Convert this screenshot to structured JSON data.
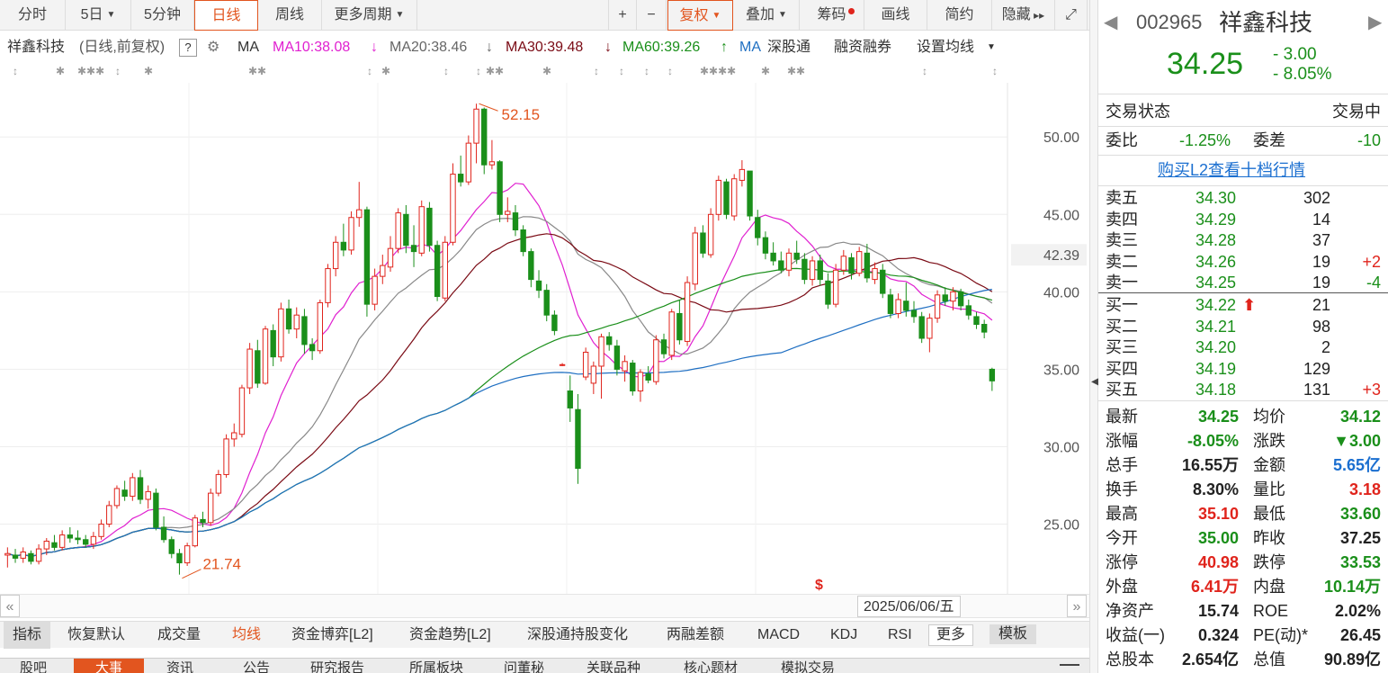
{
  "period_bar": {
    "buttons": [
      "分时",
      "5日",
      "5分钟",
      "日线",
      "周线",
      "更多周期"
    ],
    "tools": [
      "+",
      "−",
      "复权",
      "叠加",
      "筹码",
      "画线",
      "简约",
      "隐藏"
    ]
  },
  "ma_bar": {
    "name": "祥鑫科技",
    "mode": "(日线,前复权)",
    "help": "?",
    "ma_label": "MA",
    "ma10": "MA10:38.08",
    "ma20": "MA20:38.46",
    "ma30": "MA30:39.48",
    "ma60": "MA60:39.26",
    "ma_blue": "MA",
    "hk": "深股通",
    "margin": "融资融券",
    "set_ma": "设置均线"
  },
  "colors": {
    "up": "#e0241c",
    "down": "#1a8f1a",
    "ma10": "#e020d0",
    "ma20": "#888888",
    "ma30": "#7a0a14",
    "ma60": "#1a8f1a",
    "ma120": "#1f6fc2",
    "accent": "#e2551f"
  },
  "chart_data": {
    "type": "candlestick",
    "title": "",
    "y_ticks": [
      "50.00",
      "45.00",
      "40.00",
      "35.00",
      "30.00",
      "25.00"
    ],
    "ylim": [
      20.5,
      53.5
    ],
    "last_price_label": "42.39",
    "max_label": "52.15",
    "min_label": "21.74",
    "date_label": "2025/06/06/五",
    "candles": [
      [
        23,
        23.5,
        22.2,
        23.1
      ],
      [
        23,
        23.4,
        22.5,
        22.8
      ],
      [
        22.8,
        23.5,
        22.5,
        23.2
      ],
      [
        23.1,
        23.3,
        22.4,
        22.6
      ],
      [
        22.6,
        23.7,
        22.4,
        23.4
      ],
      [
        23.4,
        24.1,
        23,
        23.9
      ],
      [
        23.8,
        24.3,
        23.3,
        23.5
      ],
      [
        23.5,
        24.6,
        23.3,
        24.3
      ],
      [
        24.3,
        24.8,
        23.8,
        24.1
      ],
      [
        24.1,
        24.6,
        23.7,
        24
      ],
      [
        24,
        24.3,
        23.5,
        23.7
      ],
      [
        23.7,
        24.5,
        23.4,
        24.2
      ],
      [
        24.2,
        25.3,
        24,
        25
      ],
      [
        25,
        26.5,
        24.8,
        26.2
      ],
      [
        26.2,
        27.5,
        26,
        27.3
      ],
      [
        27.2,
        27.8,
        26.5,
        26.8
      ],
      [
        26.8,
        28.3,
        26.5,
        28
      ],
      [
        28,
        28.5,
        26.3,
        26.6
      ],
      [
        26.6,
        27.5,
        26,
        27.1
      ],
      [
        27,
        27.3,
        24.6,
        24.8
      ],
      [
        24.8,
        25.5,
        23.8,
        24
      ],
      [
        24,
        24.2,
        22.8,
        23.1
      ],
      [
        23.1,
        23.4,
        21.74,
        22.5
      ],
      [
        22.5,
        23.8,
        22.3,
        23.6
      ],
      [
        23.6,
        25.6,
        23.5,
        25.4
      ],
      [
        25.3,
        25.8,
        24.8,
        25.1
      ],
      [
        25.1,
        27.3,
        24.9,
        27
      ],
      [
        27,
        28.5,
        26.8,
        28.2
      ],
      [
        28.2,
        30.8,
        28,
        30.5
      ],
      [
        30.5,
        31.5,
        30,
        30.9
      ],
      [
        30.8,
        34,
        30.6,
        33.8
      ],
      [
        33.8,
        36.7,
        33.4,
        36.3
      ],
      [
        36.2,
        36.9,
        33.8,
        34.1
      ],
      [
        34.1,
        37.8,
        34,
        37.6
      ],
      [
        37.5,
        37.9,
        35.2,
        35.8
      ],
      [
        35.8,
        39.3,
        35.5,
        38.9
      ],
      [
        38.9,
        39.5,
        37.3,
        37.6
      ],
      [
        37.6,
        39,
        37,
        38.5
      ],
      [
        38.4,
        38.9,
        36,
        36.6
      ],
      [
        36.6,
        37,
        35.6,
        36.2
      ],
      [
        36.2,
        39.5,
        36,
        39.3
      ],
      [
        39.3,
        41.8,
        39,
        41.5
      ],
      [
        41.5,
        43.6,
        41,
        43.2
      ],
      [
        43.2,
        44.4,
        42.3,
        42.7
      ],
      [
        42.7,
        45.2,
        42.4,
        44.8
      ],
      [
        44.8,
        47.1,
        44.2,
        45.3
      ],
      [
        45.3,
        45.5,
        38.4,
        39.2
      ],
      [
        39.2,
        41.5,
        38.8,
        41
      ],
      [
        41,
        42.4,
        40.5,
        41.7
      ],
      [
        41.6,
        43.6,
        41.3,
        42.8
      ],
      [
        42.8,
        45.4,
        42.5,
        45.1
      ],
      [
        45,
        45.6,
        42.5,
        43
      ],
      [
        43,
        44.3,
        41.6,
        42.6
      ],
      [
        42.5,
        45.9,
        42.3,
        45.5
      ],
      [
        45.4,
        45.8,
        42.6,
        43
      ],
      [
        43,
        43.3,
        39.4,
        39.7
      ],
      [
        39.6,
        43.6,
        39.4,
        43.2
      ],
      [
        43.2,
        48.3,
        43,
        47.6
      ],
      [
        47.6,
        48.8,
        46.8,
        47.1
      ],
      [
        47.1,
        50.1,
        46.9,
        49.6
      ],
      [
        49.6,
        52.15,
        48.3,
        51.8
      ],
      [
        51.8,
        51.9,
        47.6,
        48.2
      ],
      [
        48.2,
        49.8,
        47.9,
        48.4
      ],
      [
        48.4,
        48.5,
        44.5,
        45
      ],
      [
        45,
        46.1,
        44.5,
        45.2
      ],
      [
        45.1,
        45.6,
        43.6,
        44
      ],
      [
        44,
        44.3,
        42.3,
        42.6
      ],
      [
        42.6,
        42.8,
        40.3,
        40.8
      ],
      [
        40.7,
        41.4,
        39.6,
        40.1
      ],
      [
        40.1,
        40.5,
        38.1,
        38.5
      ],
      [
        38.5,
        38.8,
        37.2,
        37.5
      ],
      [
        35.3,
        35.4,
        35.2,
        35.3
      ],
      [
        33.6,
        34.6,
        31.6,
        32.5
      ],
      [
        32.4,
        33.4,
        27.6,
        28.6
      ],
      [
        34.5,
        36.4,
        34.3,
        36.1
      ],
      [
        34.1,
        35.5,
        33.4,
        35.2
      ],
      [
        35.2,
        37.3,
        33.1,
        37.1
      ],
      [
        37.1,
        37.4,
        36.2,
        36.6
      ],
      [
        36.5,
        36.9,
        34.6,
        35
      ],
      [
        34.9,
        35.9,
        34.2,
        35.5
      ],
      [
        35.4,
        35.6,
        33.3,
        33.6
      ],
      [
        33.6,
        35,
        32.9,
        34.8
      ],
      [
        34.7,
        35.2,
        34.1,
        34.3
      ],
      [
        34.2,
        37.2,
        34,
        36.9
      ],
      [
        36.9,
        37.3,
        35.7,
        36
      ],
      [
        35.9,
        38.9,
        35.6,
        38.7
      ],
      [
        38.6,
        39.5,
        36.6,
        36.9
      ],
      [
        36.8,
        41,
        36.5,
        40.6
      ],
      [
        40.5,
        44.2,
        40.1,
        43.8
      ],
      [
        43.8,
        44.3,
        42.2,
        42.5
      ],
      [
        42.4,
        45.4,
        42.2,
        45
      ],
      [
        45,
        47.5,
        44.6,
        47.2
      ],
      [
        47.1,
        47.3,
        44.7,
        45
      ],
      [
        44.9,
        47.6,
        44.6,
        47.3
      ],
      [
        47.2,
        48.5,
        46.8,
        47.9
      ],
      [
        47.8,
        47.8,
        44.6,
        44.9
      ],
      [
        44.8,
        45.3,
        43,
        43.5
      ],
      [
        43.5,
        43.9,
        42.1,
        42.5
      ],
      [
        42.5,
        43.2,
        41.7,
        42
      ],
      [
        42,
        42.6,
        41.2,
        41.4
      ],
      [
        41.4,
        42.8,
        41,
        42.5
      ],
      [
        42.5,
        43.3,
        41.8,
        42.1
      ],
      [
        42.1,
        42.5,
        40.5,
        40.8
      ],
      [
        40.8,
        42.3,
        40.4,
        42
      ],
      [
        42,
        42.4,
        40.4,
        40.8
      ],
      [
        40.7,
        41.2,
        38.9,
        39.2
      ],
      [
        39.2,
        41.8,
        39,
        41.4
      ],
      [
        41.4,
        42.7,
        41.1,
        42.3
      ],
      [
        42.2,
        42.5,
        40.8,
        41.2
      ],
      [
        41.2,
        42.9,
        41,
        42.6
      ],
      [
        42.5,
        43.1,
        40.6,
        40.9
      ],
      [
        40.8,
        41.9,
        40.5,
        41.5
      ],
      [
        41.4,
        41.8,
        39.6,
        39.9
      ],
      [
        39.8,
        40.2,
        38.3,
        38.6
      ],
      [
        38.6,
        39.9,
        38.3,
        39.5
      ],
      [
        39.4,
        40.6,
        38.4,
        38.8
      ],
      [
        38.8,
        39.4,
        38,
        38.4
      ],
      [
        38.4,
        38.7,
        36.7,
        37
      ],
      [
        37,
        38.6,
        36.1,
        38.3
      ],
      [
        38.3,
        40.1,
        38,
        39.8
      ],
      [
        39.8,
        40.3,
        39.1,
        39.4
      ],
      [
        39.4,
        40.3,
        38.8,
        40
      ],
      [
        40,
        40.2,
        38.8,
        39.1
      ],
      [
        39.1,
        39.5,
        38.2,
        38.5
      ],
      [
        38.4,
        38.7,
        37.6,
        37.9
      ],
      [
        37.9,
        38.2,
        37,
        37.4
      ],
      [
        35,
        35.1,
        33.6,
        34.25
      ]
    ]
  },
  "quote": {
    "code": "002965",
    "name": "祥鑫科技",
    "price": "34.25",
    "change": "- 3.00",
    "change_pct": "- 8.05%",
    "status_label": "交易状态",
    "status_value": "交易中",
    "weibi_label": "委比",
    "weibi": "-1.25%",
    "weicha_label": "委差",
    "weicha": "-10",
    "l2_link": "购买L2查看十档行情",
    "asks": [
      {
        "label": "卖五",
        "price": "34.30",
        "vol": "302",
        "chg": ""
      },
      {
        "label": "卖四",
        "price": "34.29",
        "vol": "14",
        "chg": ""
      },
      {
        "label": "卖三",
        "price": "34.28",
        "vol": "37",
        "chg": ""
      },
      {
        "label": "卖二",
        "price": "34.26",
        "vol": "19",
        "chg": "+2"
      },
      {
        "label": "卖一",
        "price": "34.25",
        "vol": "19",
        "chg": "-4"
      }
    ],
    "bids": [
      {
        "label": "买一",
        "price": "34.22",
        "vol": "21",
        "chg": ""
      },
      {
        "label": "买二",
        "price": "34.21",
        "vol": "98",
        "chg": ""
      },
      {
        "label": "买三",
        "price": "34.20",
        "vol": "2",
        "chg": ""
      },
      {
        "label": "买四",
        "price": "34.19",
        "vol": "129",
        "chg": ""
      },
      {
        "label": "买五",
        "price": "34.18",
        "vol": "131",
        "chg": "+3"
      }
    ],
    "stats": [
      [
        "最新",
        "34.25",
        "均价",
        "34.12"
      ],
      [
        "涨幅",
        "-8.05%",
        "涨跌",
        "▼3.00"
      ],
      [
        "总手",
        "16.55万",
        "金额",
        "5.65亿"
      ],
      [
        "换手",
        "8.30%",
        "量比",
        "3.18"
      ],
      [
        "最高",
        "35.10",
        "最低",
        "33.60"
      ],
      [
        "今开",
        "35.00",
        "昨收",
        "37.25"
      ],
      [
        "涨停",
        "40.98",
        "跌停",
        "33.53"
      ],
      [
        "外盘",
        "6.41万",
        "内盘",
        "10.14万"
      ],
      [
        "净资产",
        "15.74",
        "ROE",
        "2.02%"
      ],
      [
        "收益(一)",
        "0.324",
        "PE(动)*",
        "26.45"
      ],
      [
        "总股本",
        "2.654亿",
        "总值",
        "90.89亿"
      ]
    ]
  },
  "indicator_bar": {
    "items": [
      "指标",
      "恢复默认",
      "成交量",
      "均线",
      "资金博弈[L2]",
      "资金趋势[L2]",
      "深股通持股变化",
      "两融差额",
      "MACD",
      "KDJ",
      "RSI",
      "更多",
      "模板"
    ]
  },
  "bottom_tabs": {
    "items": [
      "股吧",
      "大事",
      "资讯",
      "公告",
      "研究报告",
      "所属板块",
      "问董秘",
      "关联品种",
      "核心题材",
      "模拟交易"
    ]
  }
}
